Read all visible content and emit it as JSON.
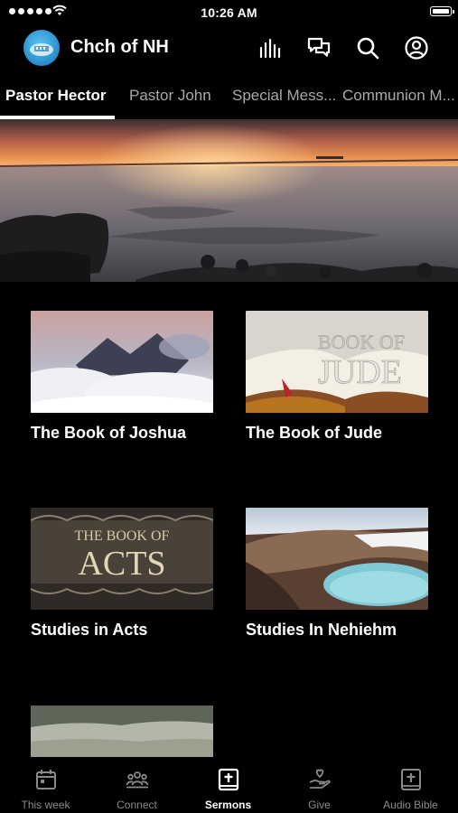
{
  "status_bar": {
    "time": "10:26 AM"
  },
  "header": {
    "app_title": "Chch of NH",
    "icons": [
      "podcast-icon",
      "chat-icon",
      "search-icon",
      "account-icon"
    ]
  },
  "tabs": [
    {
      "label": "Pastor Hector",
      "active": true
    },
    {
      "label": "Pastor John",
      "active": false
    },
    {
      "label": "Special Mess...",
      "active": false
    },
    {
      "label": "Communion M...",
      "active": false
    }
  ],
  "series": [
    {
      "title": "The Book of Joshua",
      "image": "clouds-mountains"
    },
    {
      "title": "The Book of Jude",
      "image": "open-bible",
      "image_text": [
        "BOOK OF",
        "JUDE"
      ]
    },
    {
      "title": "Studies in Acts",
      "image": "ornate-title",
      "image_text": [
        "THE BOOK OF",
        "ACTS"
      ]
    },
    {
      "title": "Studies In Nehiehm",
      "image": "crater-lake"
    },
    {
      "title": "",
      "image": "meadow"
    }
  ],
  "bottom_nav": [
    {
      "label": "This week",
      "icon": "calendar-icon",
      "active": false
    },
    {
      "label": "Connect",
      "icon": "people-icon",
      "active": false
    },
    {
      "label": "Sermons",
      "icon": "sermons-book-icon",
      "active": true
    },
    {
      "label": "Give",
      "icon": "give-hand-icon",
      "active": false
    },
    {
      "label": "Audio Bible",
      "icon": "audio-bible-icon",
      "active": false
    }
  ]
}
